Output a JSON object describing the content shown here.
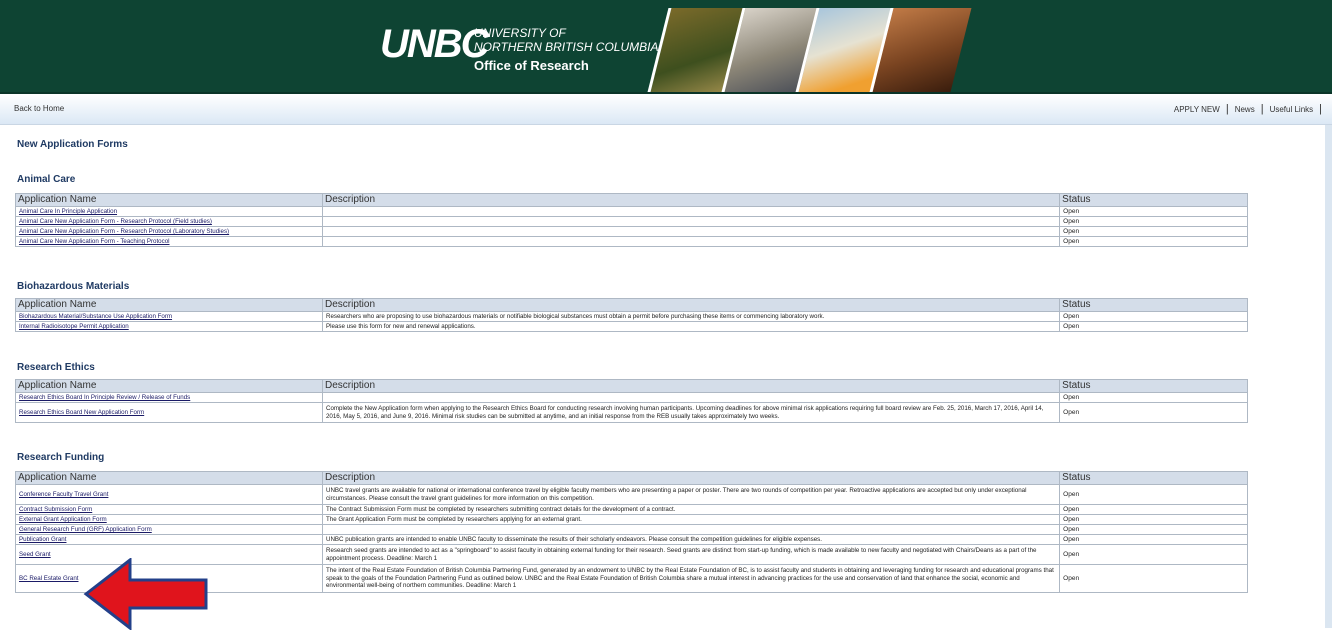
{
  "header": {
    "logo": "UNBC",
    "logo_line1": "UNIVERSITY OF",
    "logo_line2": "NORTHERN BRITISH COLUMBIA",
    "office": "Office of Research"
  },
  "nav": {
    "back_home": "Back to Home",
    "links": [
      "APPLY NEW",
      "News",
      "Useful Links"
    ]
  },
  "page_title": "New Application Forms",
  "table_headers": {
    "name": "Application Name",
    "description": "Description",
    "status": "Status"
  },
  "sections": [
    {
      "title": "Animal Care",
      "rows": [
        {
          "name": "Animal Care In Principle Application",
          "description": "",
          "status": "Open"
        },
        {
          "name": "Animal Care New Application Form - Research Protocol (Field studies)",
          "description": "",
          "status": "Open"
        },
        {
          "name": "Animal Care New Application Form - Research Protocol (Laboratory Studies)",
          "description": "",
          "status": "Open"
        },
        {
          "name": "Animal Care New Application Form - Teaching Protocol",
          "description": "",
          "status": "Open"
        }
      ]
    },
    {
      "title": "Biohazardous Materials",
      "rows": [
        {
          "name": "Biohazardous Material/Substance Use Application Form",
          "description": "Researchers who are proposing to use biohazardous materials or notifiable biological substances must obtain a permit before purchasing these items or commencing laboratory work.",
          "status": "Open"
        },
        {
          "name": "Internal Radioisotope Permit Application",
          "description": "Please use this form for new and renewal applications.",
          "status": "Open"
        }
      ]
    },
    {
      "title": "Research Ethics",
      "rows": [
        {
          "name": "Research Ethics Board In Principle Review / Release of Funds",
          "description": "",
          "status": "Open"
        },
        {
          "name": "Research Ethics Board New Application Form",
          "description": "Complete the New Application form when applying to the Research Ethics Board for conducting research involving human participants. Upcoming deadlines for above minimal risk applications requiring full board review are Feb. 25, 2016, March 17, 2016, April 14, 2016, May 5, 2016, and June 9, 2016. Minimal risk studies can be submitted at anytime, and an initial response from the REB usually takes approximately two weeks.",
          "status": "Open"
        }
      ]
    },
    {
      "title": "Research Funding",
      "rows": [
        {
          "name": "Conference Faculty Travel Grant",
          "description": "UNBC travel grants are available for national or international conference travel by eligible faculty members who are presenting a paper or poster. There are two rounds of competition per year. Retroactive applications are accepted but only under exceptional circumstances. Please consult the travel grant guidelines for more information on this competition.",
          "status": "Open"
        },
        {
          "name": "Contract Submission Form",
          "description": "The Contract Submission Form must be completed by researchers submitting contract details for the development of a contract.",
          "status": "Open"
        },
        {
          "name": "External Grant Application Form",
          "description": "The Grant Application Form must be completed by researchers applying for an external grant.",
          "status": "Open"
        },
        {
          "name": "General Research Fund (GRF) Application Form",
          "description": "",
          "status": "Open"
        },
        {
          "name": "Publication Grant",
          "description": "UNBC publication grants are intended to enable UNBC faculty to disseminate the results of their scholarly endeavors. Please consult the competition guidelines for eligible expenses.",
          "status": "Open"
        },
        {
          "name": "Seed Grant",
          "description": "Research seed grants are intended to act as a \"springboard\" to assist faculty in obtaining external funding for their research. Seed grants are distinct from start-up funding, which is made available to new faculty and negotiated with Chairs/Deans as a part of the appointment process. Deadline: March 1",
          "status": "Open"
        },
        {
          "name": "BC Real Estate Grant",
          "description": "The intent of the Real Estate Foundation of British Columbia Partnering Fund, generated by an endowment to UNBC by the Real Estate Foundation of BC, is to assist faculty and students in obtaining and leveraging funding for research and educational programs that speak to the goals of the Foundation Partnering Fund as outlined below. UNBC and the Real Estate Foundation of British Columbia share a mutual interest in advancing practices for the use and conservation of land that enhance the social, economic and environmental well-being of northern communities. Deadline: March 1",
          "status": "Open"
        }
      ]
    }
  ],
  "colors": {
    "banner": "#0e4433",
    "heading": "#1f3a63",
    "table_header": "#d4dde9",
    "arrow": "#e0141c"
  }
}
